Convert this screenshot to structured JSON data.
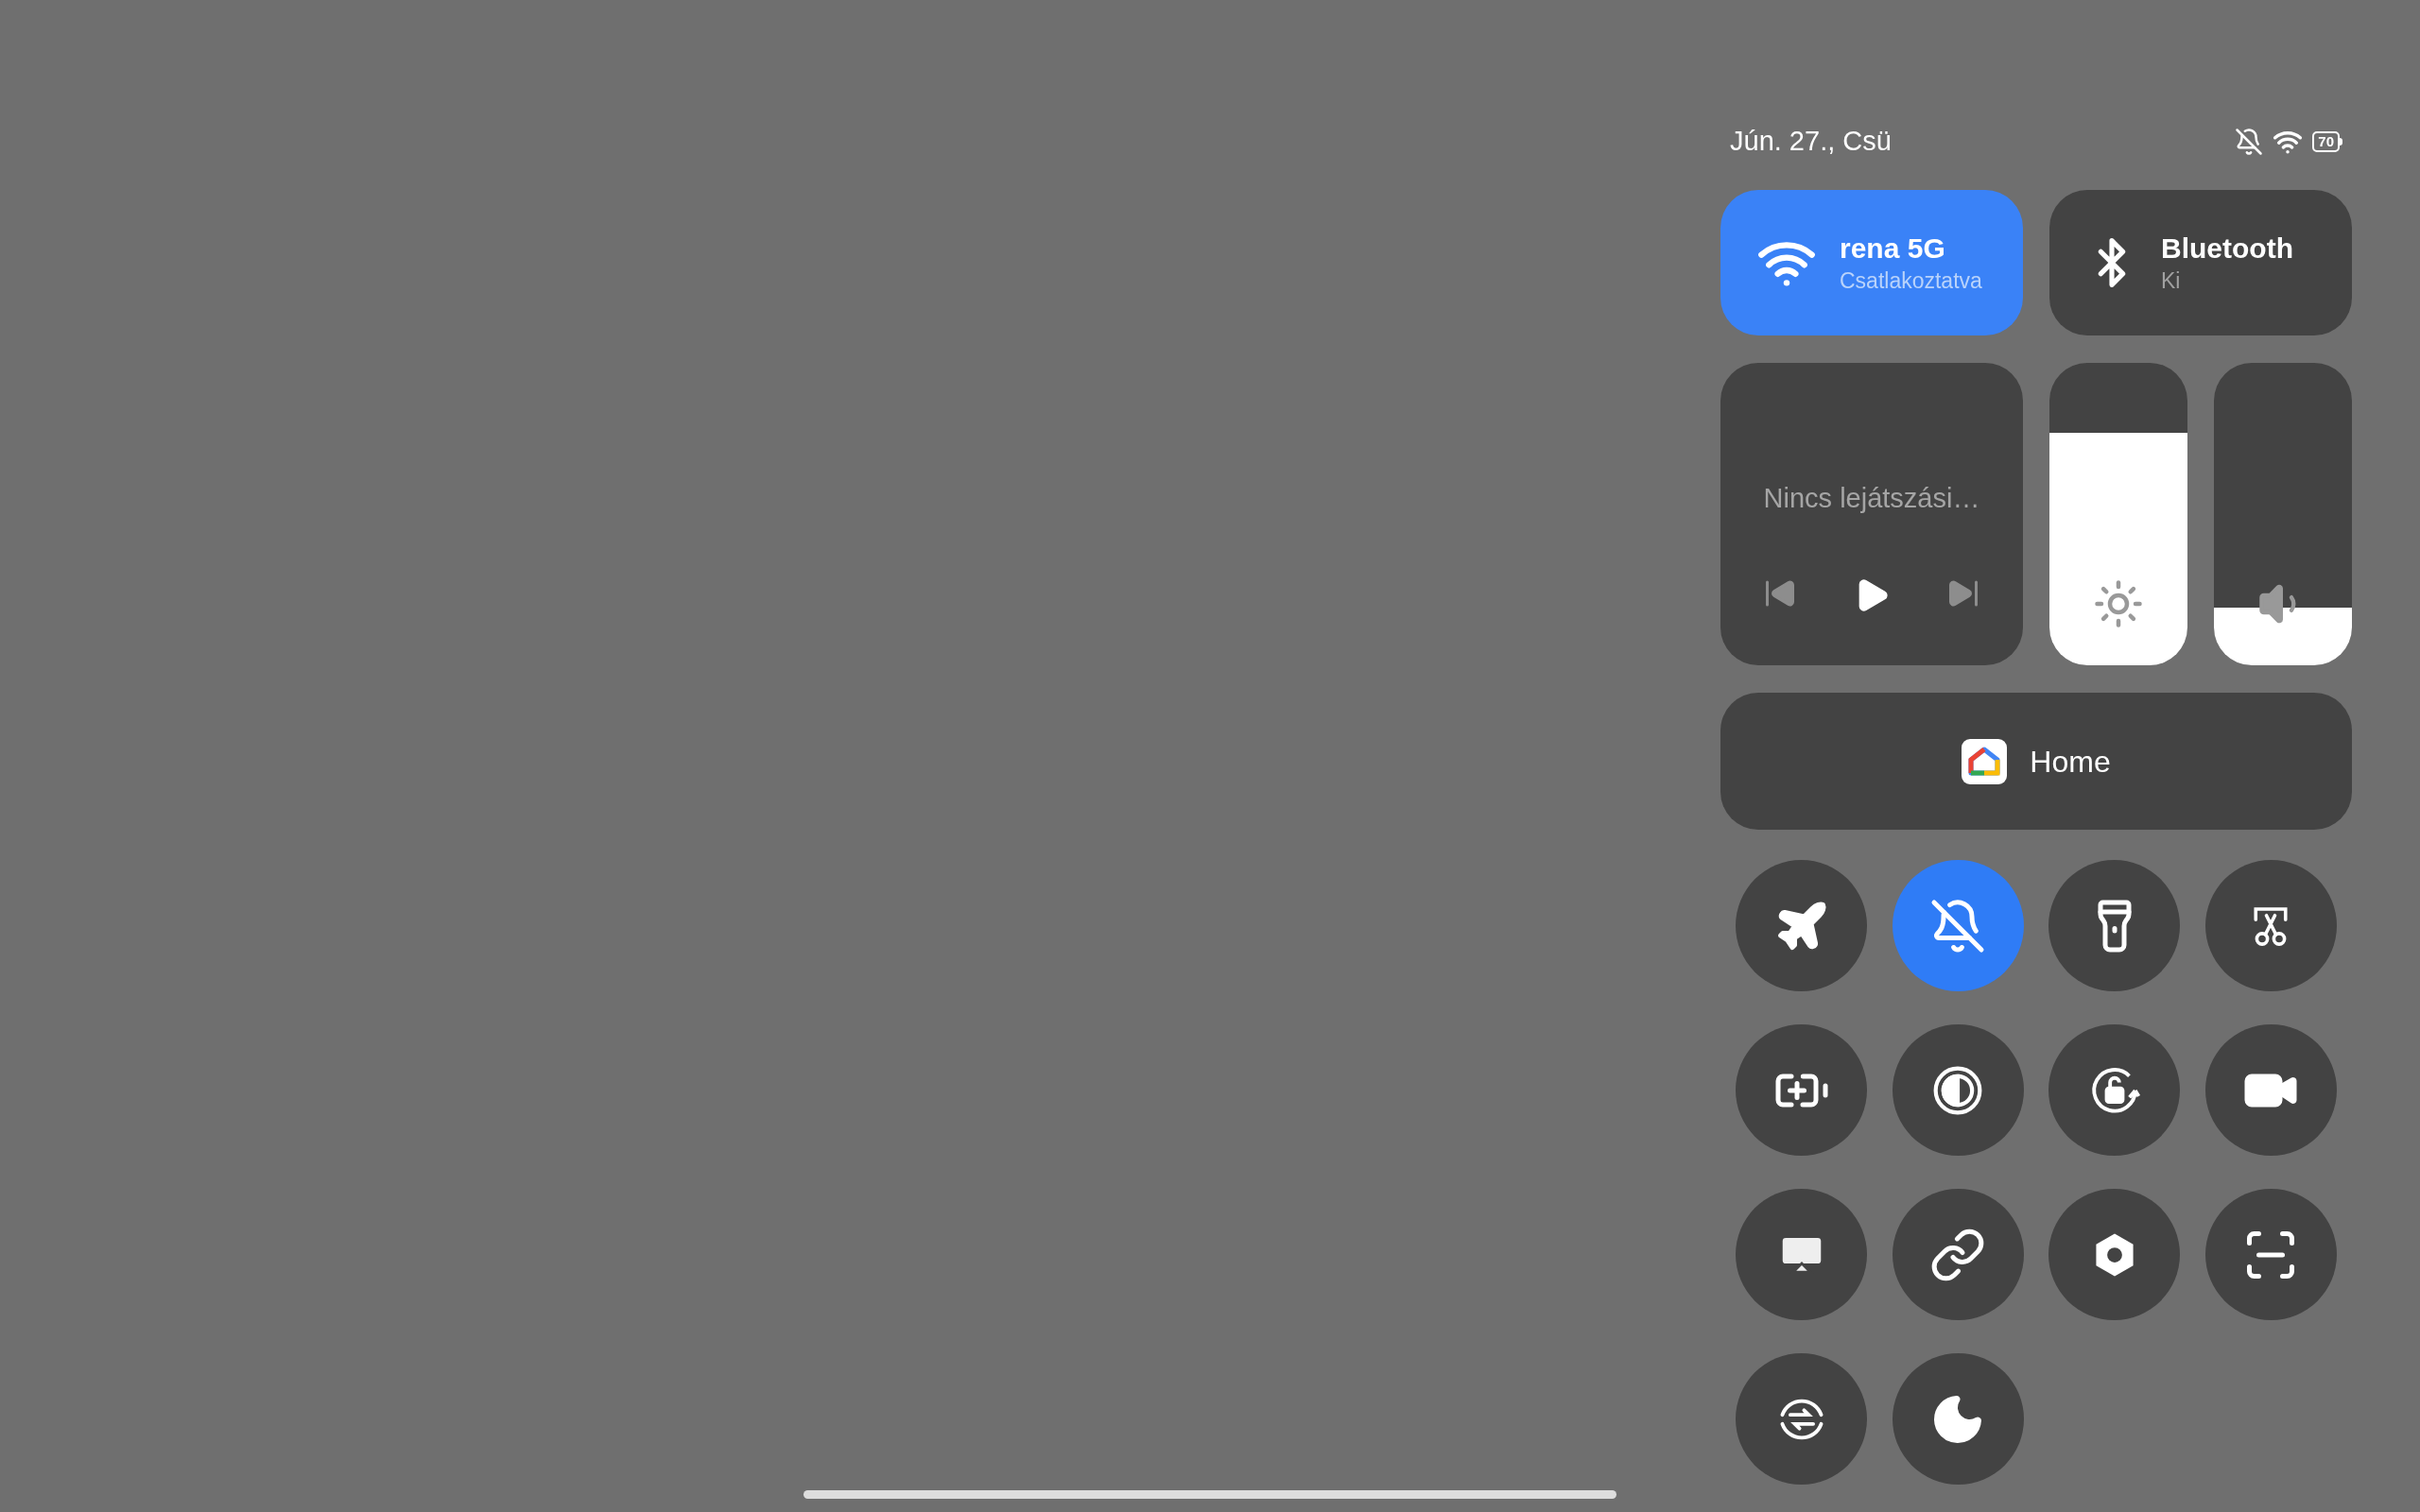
{
  "status_bar": {
    "date": "Jún. 27., Csü",
    "battery": "70"
  },
  "tiles": [
    {
      "kind": "wifi",
      "title": "rena 5G",
      "subtitle": "Csatlakoztatva",
      "on": true
    },
    {
      "kind": "bluetooth",
      "title": "Bluetooth",
      "subtitle": "Ki",
      "on": false
    }
  ],
  "media": {
    "text": "Nincs lejátszási…"
  },
  "sliders": [
    {
      "kind": "brightness",
      "level": 0.77
    },
    {
      "kind": "volume",
      "level": 0.19
    }
  ],
  "home_button": {
    "label": "Home"
  },
  "toggles": [
    {
      "kind": "airplane",
      "on": false
    },
    {
      "kind": "mute",
      "on": true
    },
    {
      "kind": "flashlight",
      "on": false
    },
    {
      "kind": "screenshot",
      "on": false
    },
    {
      "kind": "battery_saver",
      "on": false
    },
    {
      "kind": "contrast",
      "on": false
    },
    {
      "kind": "rotation_lock",
      "on": false
    },
    {
      "kind": "screen_record",
      "on": false
    },
    {
      "kind": "cast",
      "on": false
    },
    {
      "kind": "link",
      "on": false
    },
    {
      "kind": "nut",
      "on": false
    },
    {
      "kind": "scanner",
      "on": false
    },
    {
      "kind": "sync",
      "on": false
    },
    {
      "kind": "dark_mode",
      "on": false
    }
  ]
}
